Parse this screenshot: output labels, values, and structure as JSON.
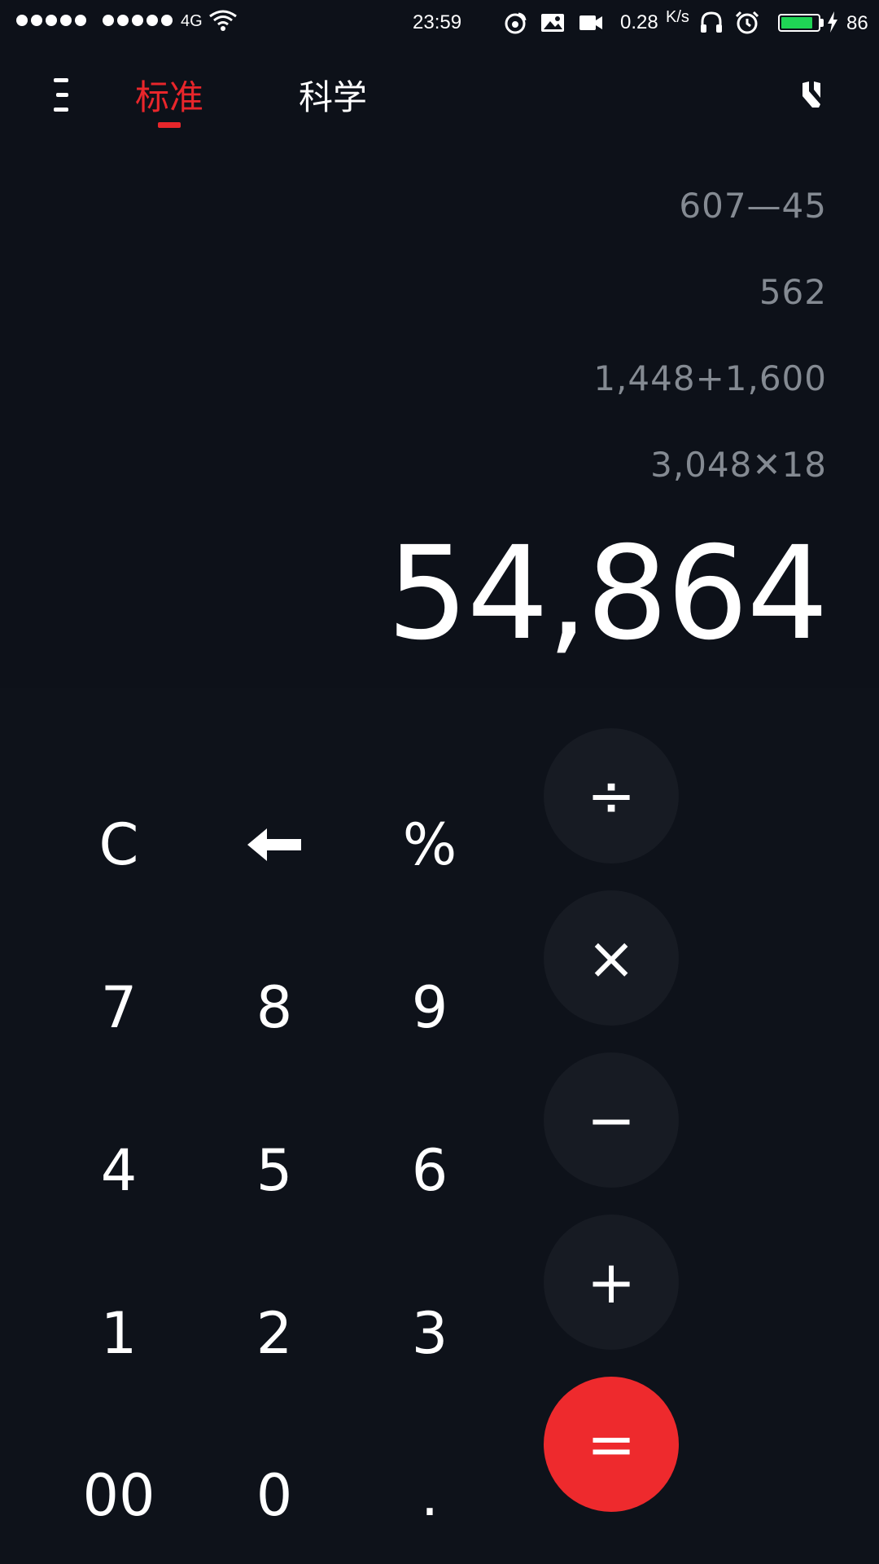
{
  "status_bar": {
    "network": "4G",
    "time": "23:59",
    "speed": "0.28",
    "speed_unit": "K/s",
    "battery": "86",
    "battery_level_percent": 86,
    "battery_color": "#1fd655"
  },
  "toolbar": {
    "tabs": [
      {
        "label": "标准",
        "active": true
      },
      {
        "label": "科学",
        "active": false
      }
    ],
    "accent_color": "#e8262b"
  },
  "display": {
    "history": [
      "607—45",
      "562",
      "1,448+1,600",
      "3,048✕18"
    ],
    "result": "54,864"
  },
  "keypad": {
    "clear": "C",
    "backspace_icon": "back-arrow-icon",
    "percent": "%",
    "divide": "÷",
    "multiply": "×",
    "minus": "−",
    "plus": "+",
    "equals": "=",
    "equals_color": "#ee2a2d",
    "digits": {
      "d7": "7",
      "d8": "8",
      "d9": "9",
      "d4": "4",
      "d5": "5",
      "d6": "6",
      "d1": "1",
      "d2": "2",
      "d3": "3",
      "d00": "00",
      "d0": "0",
      "dot": "."
    }
  }
}
